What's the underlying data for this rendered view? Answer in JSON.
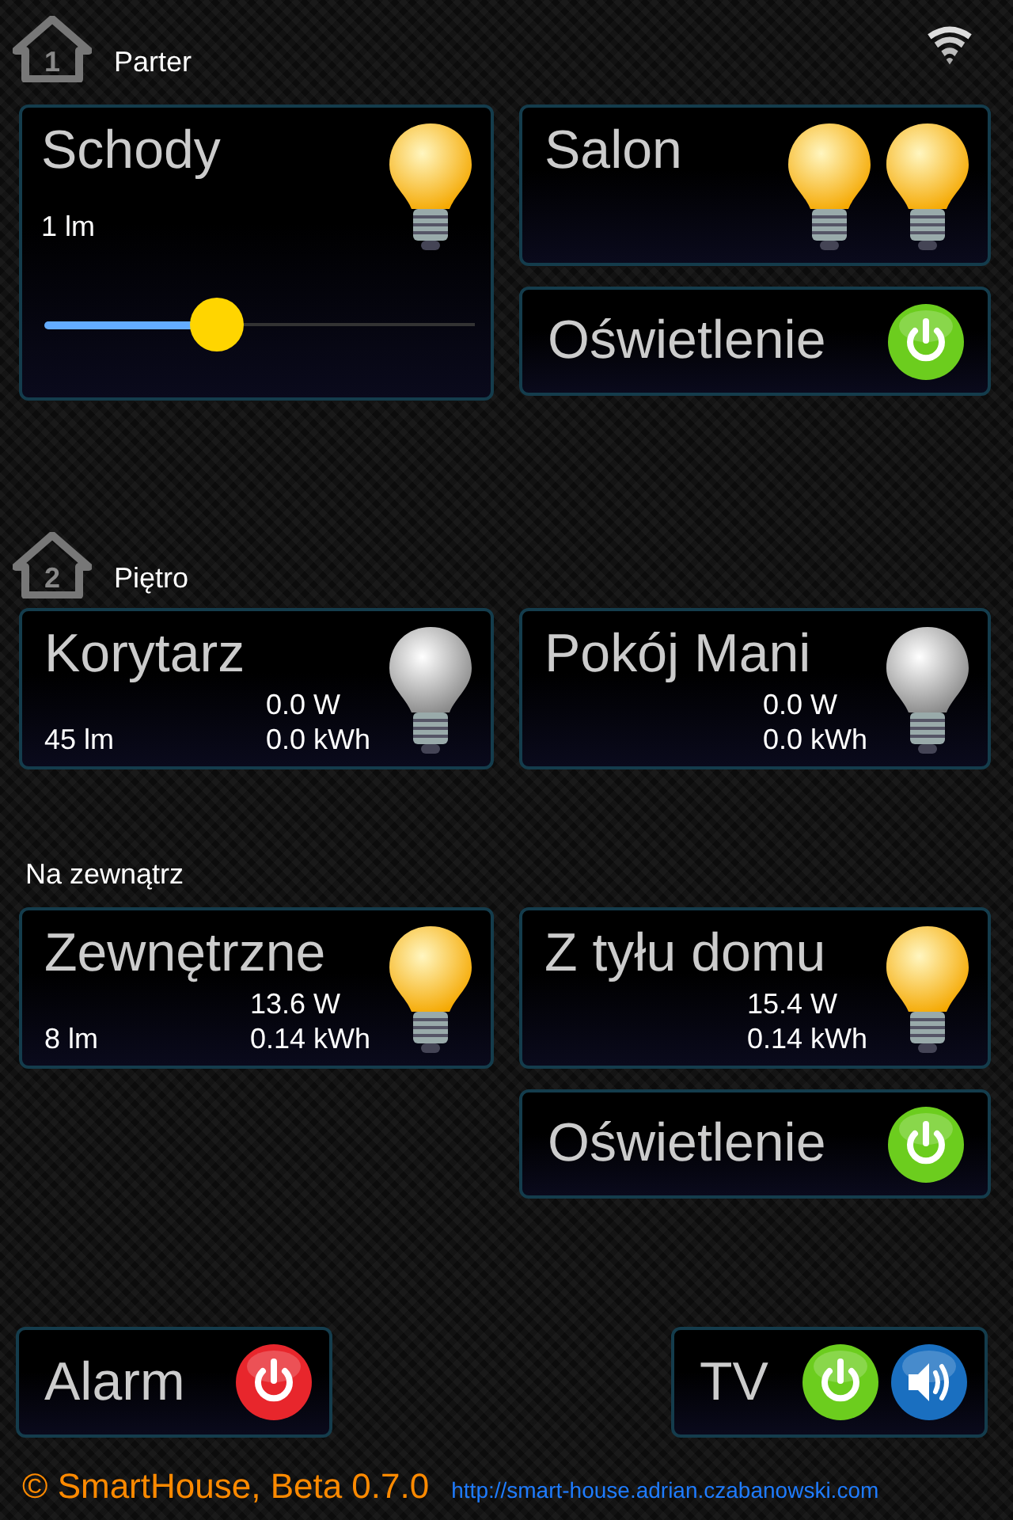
{
  "sections": [
    {
      "number": "1",
      "label": "Parter",
      "columns": [
        [
          {
            "kind": "dimmer",
            "name": "Schody",
            "lumens": "1 lm",
            "level": 0.4,
            "bulbs": [
              {
                "on": true
              }
            ]
          }
        ],
        [
          {
            "kind": "light",
            "name": "Salon",
            "bulbs": [
              {
                "on": true
              },
              {
                "on": true
              }
            ]
          },
          {
            "kind": "switch",
            "name": "Oświetlenie",
            "on": true
          }
        ]
      ]
    },
    {
      "number": "2",
      "label": "Piętro",
      "columns": [
        [
          {
            "kind": "light",
            "name": "Korytarz",
            "lumens": "45 lm",
            "power": "0.0 W",
            "energy": "0.0 kWh",
            "bulbs": [
              {
                "on": false
              }
            ]
          }
        ],
        [
          {
            "kind": "light",
            "name": "Pokój Mani",
            "power": "0.0 W",
            "energy": "0.0 kWh",
            "bulbs": [
              {
                "on": false
              }
            ]
          }
        ]
      ]
    },
    {
      "label": "Na zewnątrz",
      "columns": [
        [
          {
            "kind": "light",
            "name": "Zewnętrzne",
            "lumens": "8 lm",
            "power": "13.6 W",
            "energy": "0.14 kWh",
            "bulbs": [
              {
                "on": true
              }
            ]
          }
        ],
        [
          {
            "kind": "light",
            "name": "Z tyłu domu",
            "power": "15.4 W",
            "energy": "0.14 kWh",
            "bulbs": [
              {
                "on": true
              }
            ]
          },
          {
            "kind": "switch",
            "name": "Oświetlenie",
            "on": true
          }
        ]
      ]
    }
  ],
  "controls": [
    {
      "name": "Alarm",
      "buttons": [
        {
          "kind": "power",
          "on": false
        }
      ]
    },
    {
      "name": "TV",
      "buttons": [
        {
          "kind": "power",
          "on": true
        },
        {
          "kind": "volume"
        }
      ]
    }
  ],
  "footer": {
    "copyright": "© SmartHouse, Beta 0.7.0",
    "link": "http://smart-house.adrian.czabanowski.com"
  }
}
